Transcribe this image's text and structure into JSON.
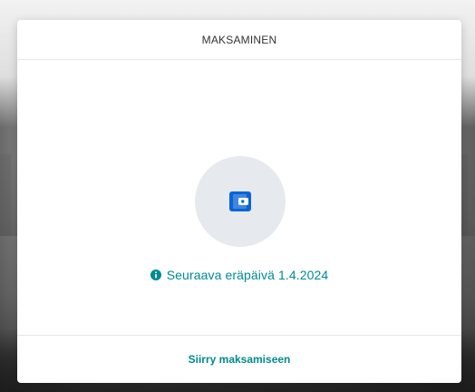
{
  "header": {
    "title": "MAKSAMINEN"
  },
  "body": {
    "icon": "wallet-icon",
    "due_text": "Seuraava eräpäivä 1.4.2024",
    "info_icon": "info-icon"
  },
  "footer": {
    "link_label": "Siirry maksamiseen"
  },
  "colors": {
    "accent": "#008a92",
    "icon_blue": "#0a64d8",
    "circle_bg": "#e6e9ee"
  }
}
